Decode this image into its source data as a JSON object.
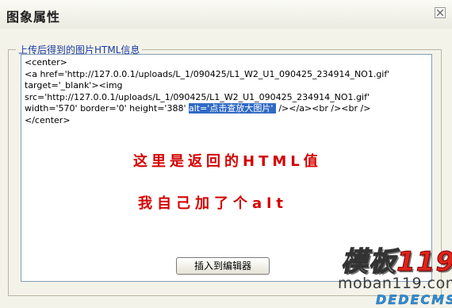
{
  "window": {
    "title": "图象属性",
    "close_icon": "close-icon"
  },
  "fieldset": {
    "legend": "上传后得到的图片HTML信息"
  },
  "code": {
    "line1": "<center>",
    "line2": "<a href='http://127.0.0.1/uploads/L_1/090425/L1_W2_U1_090425_234914_NO1.gif'",
    "line3": "target='_blank'><img",
    "line4": "src='http://127.0.0.1/uploads/L_1/090425/L1_W2_U1_090425_234914_NO1.gif'",
    "line5_before": "width='570' border='0' height='388' ",
    "line5_selected": "alt='点击查放大图片' ",
    "line5_after": " /></a><br /><br />",
    "line6": "</center>"
  },
  "annotations": {
    "note1": "这里是返回的HTML值",
    "note2": "我自己加了个alt"
  },
  "buttons": {
    "insert": "插入到编辑器"
  },
  "watermark": {
    "logo_text": "模板",
    "logo_number": "119",
    "site": "moban119.com",
    "brand": "DEDECMS"
  },
  "colors": {
    "annotation": "#d40000",
    "selection": "#316ac5",
    "legend": "#1a3aa5"
  }
}
